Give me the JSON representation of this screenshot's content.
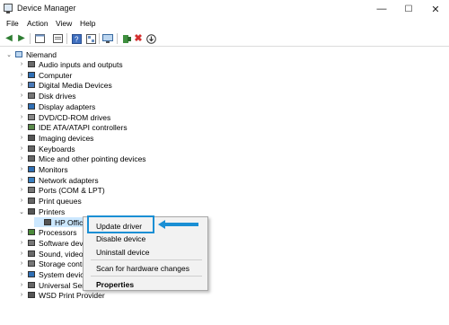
{
  "window": {
    "title": "Device Manager",
    "minimize": "—",
    "maximize": "☐",
    "close": "✕"
  },
  "menu": [
    "File",
    "Action",
    "View",
    "Help"
  ],
  "toolbar": {
    "buttons": [
      "back-icon",
      "forward-icon",
      "properties-icon",
      "update-icon",
      "help-icon",
      "show-hidden-icon",
      "monitor-icon",
      "add-driver-icon",
      "uninstall-icon",
      "download-icon"
    ]
  },
  "tree": {
    "root": "Niemand",
    "categories": [
      {
        "label": "Audio inputs and outputs",
        "icon": "speaker-icon",
        "color": "#6a6a6a"
      },
      {
        "label": "Computer",
        "icon": "computer-icon",
        "color": "#2f6fb5"
      },
      {
        "label": "Digital Media Devices",
        "icon": "media-icon",
        "color": "#4a7ab8"
      },
      {
        "label": "Disk drives",
        "icon": "disk-icon",
        "color": "#777777"
      },
      {
        "label": "Display adapters",
        "icon": "display-icon",
        "color": "#2f6fb5"
      },
      {
        "label": "DVD/CD-ROM drives",
        "icon": "dvd-icon",
        "color": "#888888"
      },
      {
        "label": "IDE ATA/ATAPI controllers",
        "icon": "ide-icon",
        "color": "#5a8a4a"
      },
      {
        "label": "Imaging devices",
        "icon": "camera-icon",
        "color": "#555555"
      },
      {
        "label": "Keyboards",
        "icon": "keyboard-icon",
        "color": "#666666"
      },
      {
        "label": "Mice and other pointing devices",
        "icon": "mouse-icon",
        "color": "#666666"
      },
      {
        "label": "Monitors",
        "icon": "monitor-icon",
        "color": "#2f6fb5"
      },
      {
        "label": "Network adapters",
        "icon": "network-icon",
        "color": "#3a7fc0"
      },
      {
        "label": "Ports (COM & LPT)",
        "icon": "port-icon",
        "color": "#777777"
      },
      {
        "label": "Print queues",
        "icon": "print-queue-icon",
        "color": "#666666"
      },
      {
        "label": "Printers",
        "icon": "printer-icon",
        "color": "#555555",
        "expanded": true
      },
      {
        "label": "HP Offic",
        "icon": "printer-icon",
        "color": "#555555",
        "child": true
      },
      {
        "label": "Processors",
        "icon": "processor-icon",
        "color": "#4a8a3a"
      },
      {
        "label": "Software dev",
        "icon": "software-icon",
        "color": "#777777"
      },
      {
        "label": "Sound, video",
        "icon": "sound-icon",
        "color": "#6a6a6a"
      },
      {
        "label": "Storage contr",
        "icon": "storage-icon",
        "color": "#777777"
      },
      {
        "label": "System devic",
        "icon": "system-icon",
        "color": "#2f6fb5"
      },
      {
        "label": "Universal Ser",
        "icon": "usb-icon",
        "color": "#666666"
      },
      {
        "label": "WSD Print Provider",
        "icon": "wsd-icon",
        "color": "#555555"
      }
    ]
  },
  "context_menu": {
    "items": [
      "Update driver",
      "Disable device",
      "Uninstall device",
      "Scan for hardware changes",
      "Properties"
    ]
  },
  "colors": {
    "highlight": "#1a8fd4",
    "selection": "#cce8ff"
  }
}
